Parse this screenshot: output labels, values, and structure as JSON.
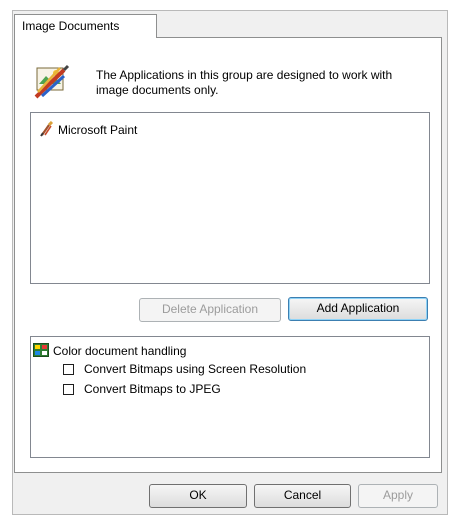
{
  "tab": {
    "label": "Image Documents"
  },
  "description": "The Applications in this group are designed to work with image documents only.",
  "applications": [
    {
      "name": "Microsoft Paint",
      "icon": "paintbrush-icon"
    }
  ],
  "buttons": {
    "delete_application": "Delete Application",
    "add_application": "Add Application",
    "ok": "OK",
    "cancel": "Cancel",
    "apply": "Apply"
  },
  "color_handling": {
    "heading": "Color document handling",
    "options": [
      {
        "label": "Convert Bitmaps using Screen Resolution",
        "checked": false
      },
      {
        "label": "Convert Bitmaps to JPEG",
        "checked": false
      }
    ]
  }
}
